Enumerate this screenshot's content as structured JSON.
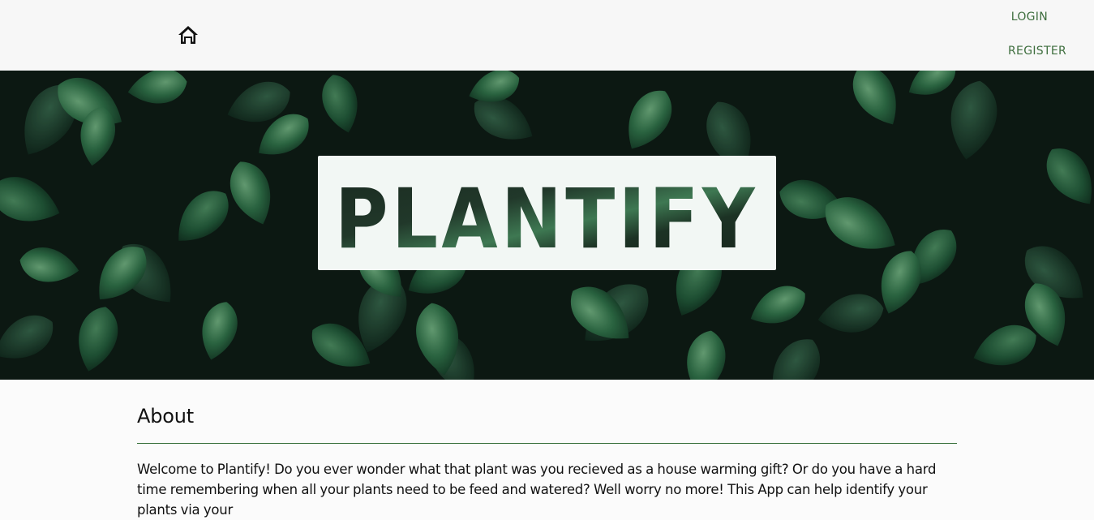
{
  "nav": {
    "home_icon": "home-icon",
    "login_label": "LOGIN",
    "register_label": "REGISTER"
  },
  "hero": {
    "logo_text": "PLANTIFY",
    "background": "leaves-image"
  },
  "about": {
    "title": "About",
    "text": "Welcome to Plantify! Do you ever wonder what that plant was you recieved as a house warming gift? Or do you have a hard time remembering when all your plants need to be feed and watered? Well worry no more! This App can help identify your plants via your"
  },
  "colors": {
    "accent": "#3e6e3e",
    "divider": "#2f6a33",
    "header_bg": "#f7f7f7",
    "logo_box": "#f2f7f4"
  }
}
